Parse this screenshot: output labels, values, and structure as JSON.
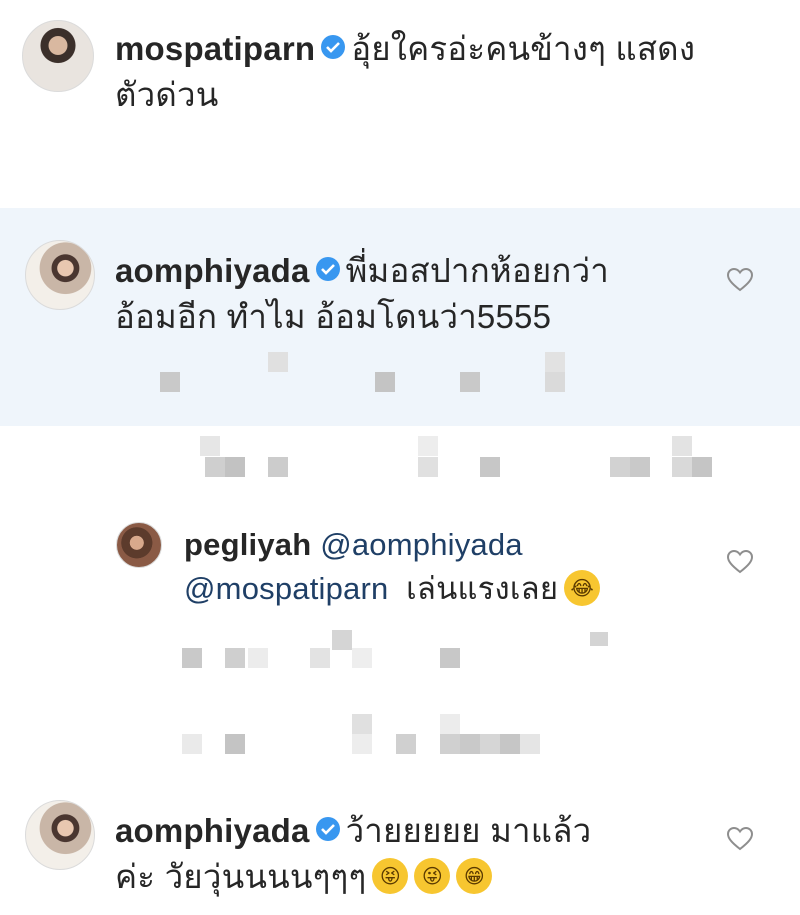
{
  "comments": [
    {
      "username": "mospatiparn",
      "verified": true,
      "text": "อุ้ยใครอ่ะคนข้างๆ แสดงตัวด่วน",
      "line1": "อุ้ยใครอ่ะคนข้างๆ แสดง",
      "line2": "ตัวด่วน"
    },
    {
      "username": "aomphiyada",
      "verified": true,
      "text": "พี่มอสปากห้อยกว่าอ้อมอีก ทำไม อ้อมโดนว่า5555",
      "line1": "พี่มอสปากห้อยกว่า",
      "line2": "อ้อมอีก ทำไม อ้อมโดนว่า5555",
      "highlighted": true
    },
    {
      "username": "pegliyah",
      "verified": false,
      "mention1": "@aomphiyada",
      "mention2": "@mospatiparn",
      "text": "เล่นแรงเลย",
      "emoji": "face-with-tears-of-joy"
    },
    {
      "username": "aomphiyada",
      "verified": true,
      "text": "ว้ายยยยย มาแล้วค่ะ วัยวุ่นนนนๆๆๆ",
      "line1": "ว้ายยยยย มาแล้ว",
      "line2": "ค่ะ วัยวุ่นนนนๆๆๆ",
      "emojis": [
        "squinting-tongue-face",
        "winking-tongue-face",
        "grinning-face"
      ]
    }
  ],
  "icons": {
    "verified": "verified-badge-icon",
    "like": "heart-outline-icon"
  },
  "colors": {
    "verified_badge": "#3897f0",
    "mention": "#1f3f66",
    "highlight_bg": "#eff5fb",
    "text": "#262626"
  }
}
